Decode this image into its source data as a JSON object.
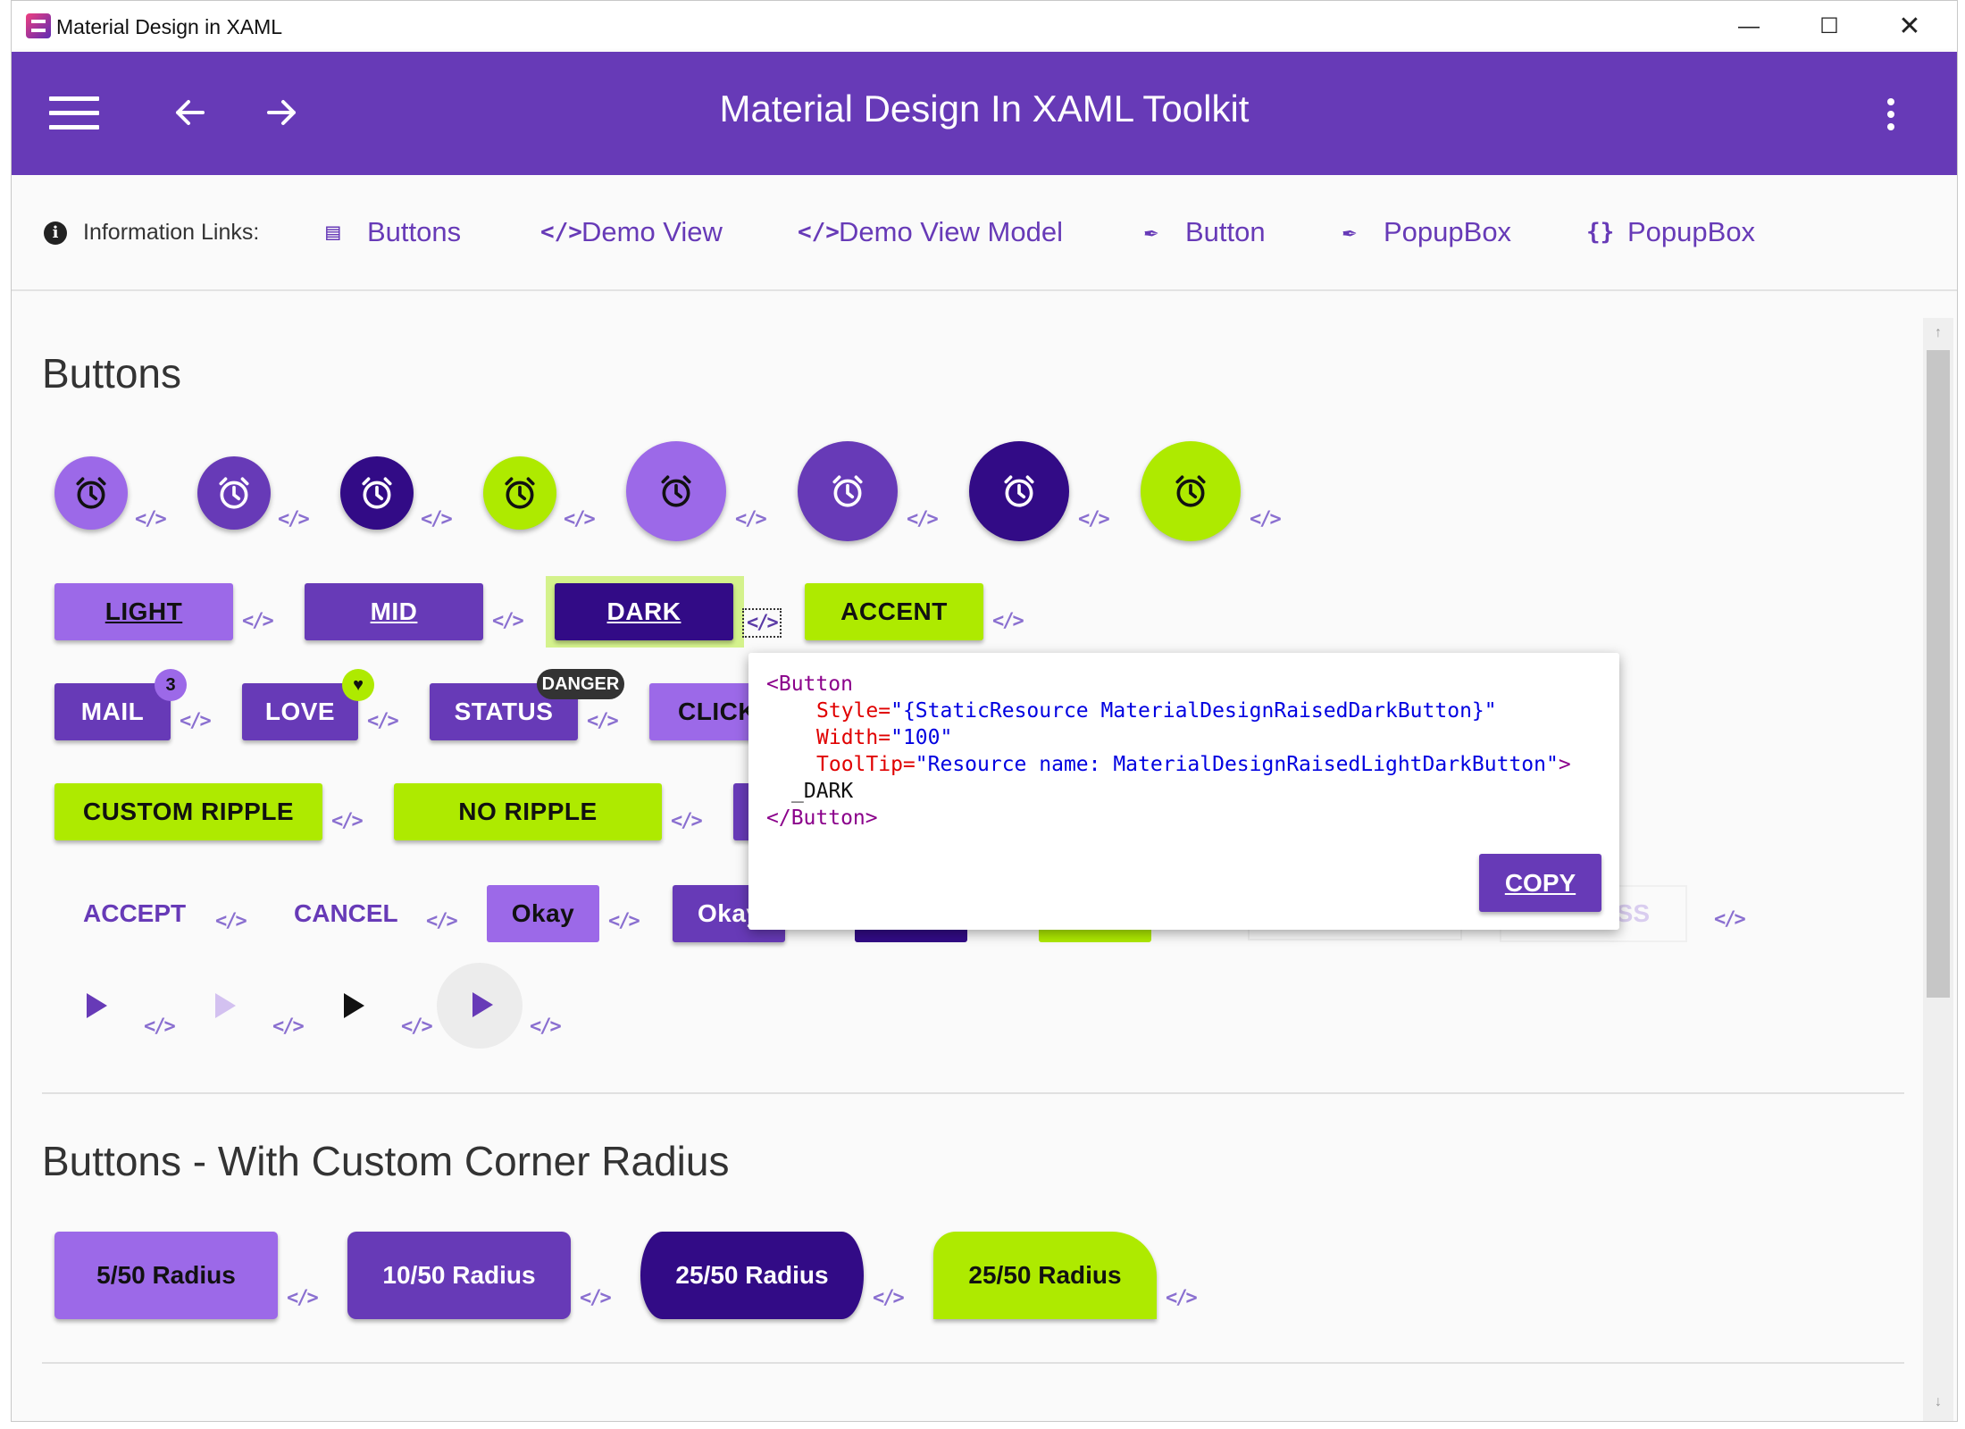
{
  "window": {
    "title": "Material Design in XAML"
  },
  "appbar": {
    "title": "Material Design In XAML Toolkit"
  },
  "info_links": {
    "label": "Information Links:",
    "items": [
      {
        "icon": "book-icon",
        "label": "Buttons"
      },
      {
        "icon": "code-icon",
        "label": "Demo View"
      },
      {
        "icon": "code-icon",
        "label": "Demo View Model"
      },
      {
        "icon": "brush-icon",
        "label": "Button"
      },
      {
        "icon": "brush-icon",
        "label": "PopupBox"
      },
      {
        "icon": "braces-icon",
        "label": "PopupBox"
      }
    ]
  },
  "sections": {
    "buttons_title": "Buttons",
    "radius_title": "Buttons - With Custom Corner Radius"
  },
  "code_glyph": "</>",
  "raised_buttons": {
    "light": "LIGHT",
    "mid": "MID",
    "dark": "DARK",
    "accent": "ACCENT"
  },
  "badged_buttons": {
    "mail": "MAIL",
    "mail_badge": "3",
    "love": "LOVE",
    "status": "STATUS",
    "status_badge": "DANGER",
    "click": "CLICK"
  },
  "ripple_buttons": {
    "custom": "CUSTOM RIPPLE",
    "none": "NO RIPPLE"
  },
  "flat_buttons": {
    "accept": "ACCEPT",
    "cancel": "CANCEL",
    "okay1": "Okay",
    "okay2": "Okay",
    "less": "LESS"
  },
  "popup": {
    "line1_tag": "<Button",
    "line2_attr": "Style=",
    "line2_val": "\"{StaticResource MaterialDesignRaisedDarkButton}\"",
    "line3_attr": "Width=",
    "line3_val": "\"100\"",
    "line4_attr": "ToolTip=",
    "line4_val": "\"Resource name: MaterialDesignRaisedLightDarkButton\"",
    "line4_end": ">",
    "line5_text": "_DARK",
    "line6_tag": "</Button>",
    "copy_label": "COPY"
  },
  "radius_buttons": [
    "5/50 Radius",
    "10/50 Radius",
    "25/50 Radius",
    "25/50 Radius"
  ],
  "colors": {
    "primary": "#673ab7",
    "light": "#9c69e8",
    "dark": "#320b86",
    "accent": "#aeea00"
  }
}
